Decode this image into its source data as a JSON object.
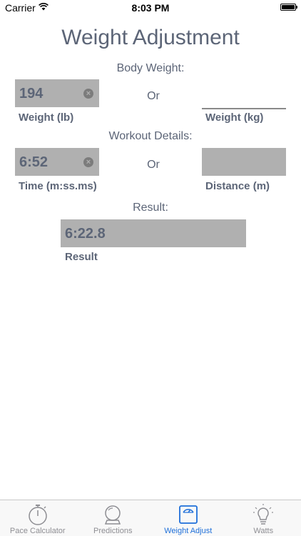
{
  "status_bar": {
    "carrier": "Carrier",
    "time": "8:03 PM"
  },
  "title": "Weight Adjustment",
  "body_weight": {
    "section_label": "Body Weight:",
    "or_label": "Or",
    "lb": {
      "value": "194",
      "label": "Weight (lb)"
    },
    "kg": {
      "value": "",
      "label": "Weight (kg)"
    }
  },
  "workout": {
    "section_label": "Workout Details:",
    "or_label": "Or",
    "time": {
      "value": "6:52",
      "label": "Time (m:ss.ms)"
    },
    "distance": {
      "value": "",
      "label": "Distance (m)"
    }
  },
  "result": {
    "section_label": "Result:",
    "value": "6:22.8",
    "label": "Result"
  },
  "tabs": [
    {
      "label": "Pace Calculator",
      "icon": "stopwatch-icon",
      "active": false
    },
    {
      "label": "Predictions",
      "icon": "crystal-ball-icon",
      "active": false
    },
    {
      "label": "Weight Adjust",
      "icon": "scale-icon",
      "active": true
    },
    {
      "label": "Watts",
      "icon": "lightbulb-icon",
      "active": false
    }
  ],
  "colors": {
    "accent": "#1e6fd9",
    "text": "#5c6577",
    "field_bg": "#b0b0b0",
    "tab_inactive": "#8e8e93"
  }
}
